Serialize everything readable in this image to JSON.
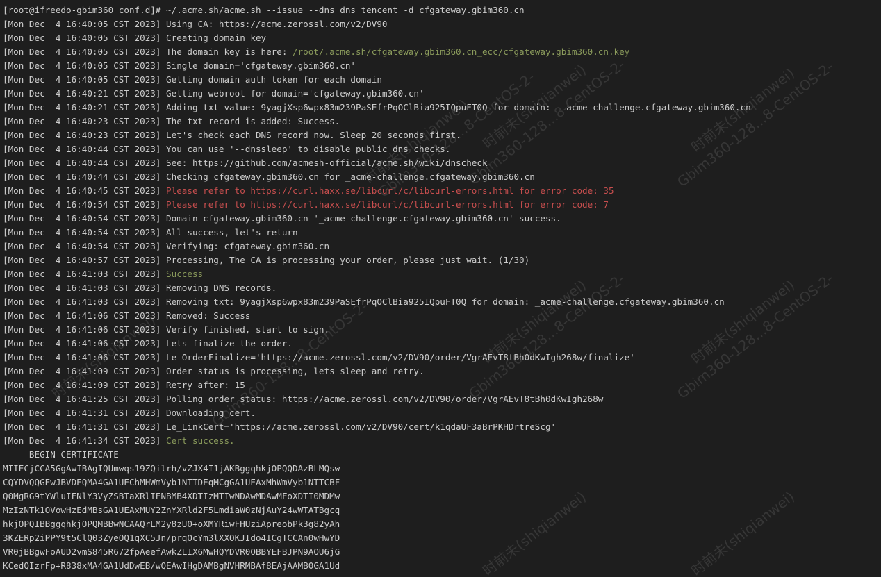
{
  "terminal": {
    "lines": [
      [
        {
          "t": "[root@ifreedo-gbim360 conf.d]# ~/.acme.sh/acme.sh --issue --dns dns_tencent -d cfgateway.gbim360.cn",
          "c": ""
        }
      ],
      [
        {
          "t": "[Mon Dec  4 16:40:05 CST 2023] Using CA: https://acme.zerossl.com/v2/DV90",
          "c": ""
        }
      ],
      [
        {
          "t": "[Mon Dec  4 16:40:05 CST 2023] Creating domain key",
          "c": ""
        }
      ],
      [
        {
          "t": "[Mon Dec  4 16:40:05 CST 2023] The domain key is here: ",
          "c": ""
        },
        {
          "t": "/root/.acme.sh/cfgateway.gbim360.cn_ecc/cfgateway.gbim360.cn.key",
          "c": "green"
        }
      ],
      [
        {
          "t": "[Mon Dec  4 16:40:05 CST 2023] Single domain='cfgateway.gbim360.cn'",
          "c": ""
        }
      ],
      [
        {
          "t": "[Mon Dec  4 16:40:05 CST 2023] Getting domain auth token for each domain",
          "c": ""
        }
      ],
      [
        {
          "t": "[Mon Dec  4 16:40:21 CST 2023] Getting webroot for domain='cfgateway.gbim360.cn'",
          "c": ""
        }
      ],
      [
        {
          "t": "[Mon Dec  4 16:40:21 CST 2023] Adding txt value: 9yagjXsp6wpx83m239PaSEfrPqOClBia925IQpuFT0Q for domain:  _acme-challenge.cfgateway.gbim360.cn",
          "c": ""
        }
      ],
      [
        {
          "t": "[Mon Dec  4 16:40:23 CST 2023] The txt record is added: Success.",
          "c": ""
        }
      ],
      [
        {
          "t": "[Mon Dec  4 16:40:23 CST 2023] Let's check each DNS record now. Sleep 20 seconds first.",
          "c": ""
        }
      ],
      [
        {
          "t": "[Mon Dec  4 16:40:44 CST 2023] You can use '--dnssleep' to disable public dns checks.",
          "c": ""
        }
      ],
      [
        {
          "t": "[Mon Dec  4 16:40:44 CST 2023] See: https://github.com/acmesh-official/acme.sh/wiki/dnscheck",
          "c": ""
        }
      ],
      [
        {
          "t": "[Mon Dec  4 16:40:44 CST 2023] Checking cfgateway.gbim360.cn for _acme-challenge.cfgateway.gbim360.cn",
          "c": ""
        }
      ],
      [
        {
          "t": "[Mon Dec  4 16:40:45 CST 2023] ",
          "c": ""
        },
        {
          "t": "Please refer to https://curl.haxx.se/libcurl/c/libcurl-errors.html for error code: 35",
          "c": "red"
        }
      ],
      [
        {
          "t": "[Mon Dec  4 16:40:54 CST 2023] ",
          "c": ""
        },
        {
          "t": "Please refer to https://curl.haxx.se/libcurl/c/libcurl-errors.html for error code: 7",
          "c": "red"
        }
      ],
      [
        {
          "t": "[Mon Dec  4 16:40:54 CST 2023] Domain cfgateway.gbim360.cn '_acme-challenge.cfgateway.gbim360.cn' success.",
          "c": ""
        }
      ],
      [
        {
          "t": "[Mon Dec  4 16:40:54 CST 2023] All success, let's return",
          "c": ""
        }
      ],
      [
        {
          "t": "[Mon Dec  4 16:40:54 CST 2023] Verifying: cfgateway.gbim360.cn",
          "c": ""
        }
      ],
      [
        {
          "t": "[Mon Dec  4 16:40:57 CST 2023] Processing, The CA is processing your order, please just wait. (1/30)",
          "c": ""
        }
      ],
      [
        {
          "t": "[Mon Dec  4 16:41:03 CST 2023] ",
          "c": ""
        },
        {
          "t": "Success",
          "c": "green"
        }
      ],
      [
        {
          "t": "[Mon Dec  4 16:41:03 CST 2023] Removing DNS records.",
          "c": ""
        }
      ],
      [
        {
          "t": "[Mon Dec  4 16:41:03 CST 2023] Removing txt: 9yagjXsp6wpx83m239PaSEfrPqOClBia925IQpuFT0Q for domain: _acme-challenge.cfgateway.gbim360.cn",
          "c": ""
        }
      ],
      [
        {
          "t": "[Mon Dec  4 16:41:06 CST 2023] Removed: Success",
          "c": ""
        }
      ],
      [
        {
          "t": "[Mon Dec  4 16:41:06 CST 2023] Verify finished, start to sign.",
          "c": ""
        }
      ],
      [
        {
          "t": "[Mon Dec  4 16:41:06 CST 2023] Lets finalize the order.",
          "c": ""
        }
      ],
      [
        {
          "t": "[Mon Dec  4 16:41:06 CST 2023] Le_OrderFinalize='https://acme.zerossl.com/v2/DV90/order/VgrAEvT8tBh0dKwIgh268w/finalize'",
          "c": ""
        }
      ],
      [
        {
          "t": "[Mon Dec  4 16:41:09 CST 2023] Order status is processing, lets sleep and retry.",
          "c": ""
        }
      ],
      [
        {
          "t": "[Mon Dec  4 16:41:09 CST 2023] Retry after: 15",
          "c": ""
        }
      ],
      [
        {
          "t": "[Mon Dec  4 16:41:25 CST 2023] Polling order status: https://acme.zerossl.com/v2/DV90/order/VgrAEvT8tBh0dKwIgh268w",
          "c": ""
        }
      ],
      [
        {
          "t": "[Mon Dec  4 16:41:31 CST 2023] Downloading cert.",
          "c": ""
        }
      ],
      [
        {
          "t": "[Mon Dec  4 16:41:31 CST 2023] Le_LinkCert='https://acme.zerossl.com/v2/DV90/cert/k1qdaUF3aBrPKHDrtreScg'",
          "c": ""
        }
      ],
      [
        {
          "t": "[Mon Dec  4 16:41:34 CST 2023] ",
          "c": ""
        },
        {
          "t": "Cert success.",
          "c": "green"
        }
      ],
      [
        {
          "t": "-----BEGIN CERTIFICATE-----",
          "c": ""
        }
      ],
      [
        {
          "t": "MIIECjCCA5GgAwIBAgIQUmwqs19ZQilrh/vZJX4I1jAKBggqhkjOPQQDAzBLMQsw",
          "c": ""
        }
      ],
      [
        {
          "t": "CQYDVQQGEwJBVDEQMA4GA1UEChMHWmVyb1NTTDEqMCgGA1UEAxMhWmVyb1NTTCBF",
          "c": ""
        }
      ],
      [
        {
          "t": "Q0MgRG9tYWluIFNlY3VyZSBTaXRlIENBMB4XDTIzMTIwNDAwMDAwMFoXDTI0MDMw",
          "c": ""
        }
      ],
      [
        {
          "t": "MzIzNTk1OVowHzEdMBsGA1UEAxMUY2ZnYXRld2F5LmdiaW0zNjAuY24wWTATBgcq",
          "c": ""
        }
      ],
      [
        {
          "t": "hkjOPQIBBggqhkjOPQMBBwNCAAQrLM2y8zU0+oXMYRiwFHUziApreobPk3g82yAh",
          "c": ""
        }
      ],
      [
        {
          "t": "3KZERp2iPPY9t5ClQ03ZyeOQ1qXC5Jn/prqOcYm3lXXOKJIdo4ICgTCCAn0wHwYD",
          "c": ""
        }
      ],
      [
        {
          "t": "VR0jBBgwFoAUD2vmS845R672fpAeefAwkZLIX6MwHQYDVR0OBBYEFBJPN9AOU6jG",
          "c": ""
        }
      ],
      [
        {
          "t": "KCedQIzrFp+R838xMA4GA1UdDwEB/wQEAwIHgDAMBgNVHRMBAf8EAjAAMB0GA1Ud",
          "c": ""
        }
      ]
    ]
  },
  "watermark": {
    "text_primary": "时前未(shiqianwei)",
    "text_secondary": "Gbim360-128...8-CentOS-2-",
    "text_partial": "Gbim360-128...8-CentOS-2-"
  }
}
